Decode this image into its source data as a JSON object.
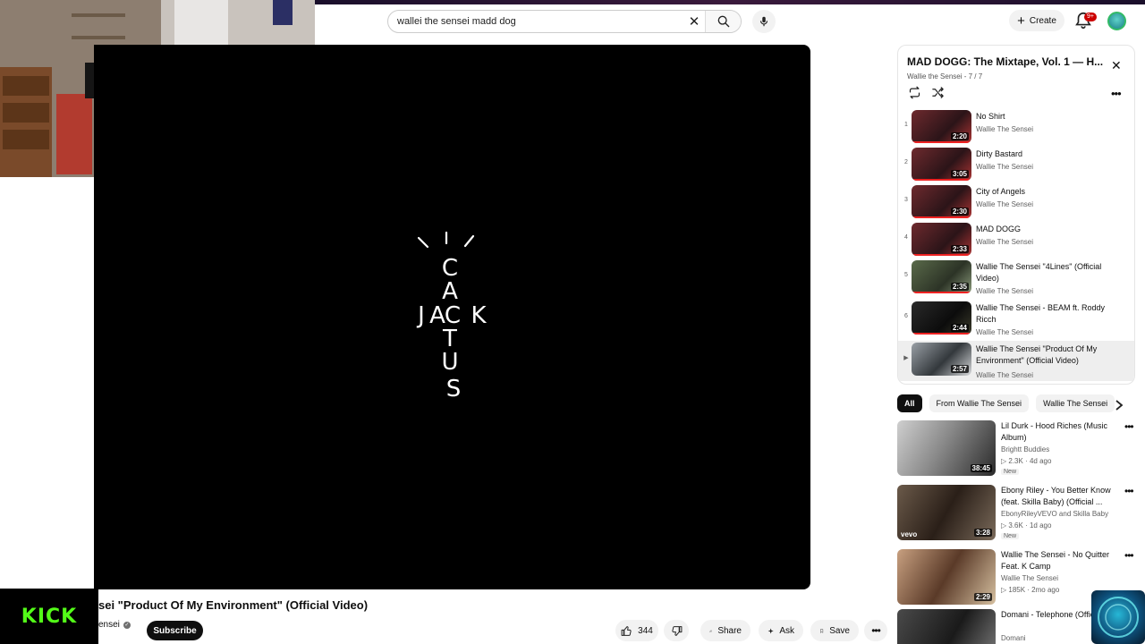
{
  "search": {
    "query": "wallei the sensei madd dog"
  },
  "header": {
    "create_label": "Create",
    "notification_count": "9+"
  },
  "overlay": {
    "kick_label": "KICK"
  },
  "video": {
    "logo_letters": [
      "C",
      "A",
      "J",
      "A",
      "C",
      "K",
      "T",
      "U",
      "S"
    ],
    "title": "sei \"Product Of My Environment\" (Official Video)",
    "channel": "ensei",
    "subscribe_label": "Subscribe",
    "likes": "344",
    "share_label": "Share",
    "ask_label": "Ask",
    "save_label": "Save"
  },
  "playlist": {
    "title": "MAD DOGG: The Mixtape, Vol. 1 — H...",
    "subtitle": "Wallie the Sensei - 7 / 7",
    "items": [
      {
        "num": "1",
        "title": "No Shirt",
        "channel": "Wallie The Sensei",
        "duration": "2:20"
      },
      {
        "num": "2",
        "title": "Dirty Bastard",
        "channel": "Wallie The Sensei",
        "duration": "3:05"
      },
      {
        "num": "3",
        "title": "City of Angels",
        "channel": "Wallie The Sensei",
        "duration": "2:30"
      },
      {
        "num": "4",
        "title": "MAD DOGG",
        "channel": "Wallie The Sensei",
        "duration": "2:33"
      },
      {
        "num": "5",
        "title": "Wallie The Sensei \"4Lines\" (Official Video)",
        "channel": "Wallie The Sensei",
        "duration": "2:35"
      },
      {
        "num": "6",
        "title": "Wallie The Sensei - BEAM ft. Roddy Ricch",
        "channel": "Wallie The Sensei",
        "duration": "2:44"
      },
      {
        "num": "▶",
        "title": "Wallie The Sensei \"Product Of My Environment\" (Official Video)",
        "channel": "Wallie The Sensei",
        "duration": "2:57"
      }
    ]
  },
  "chips": [
    "All",
    "From Wallie The Sensei",
    "Wallie The Sensei"
  ],
  "recommended": [
    {
      "title": "Lil Durk - Hood Riches (Music Album)",
      "channel": "Brightt Buddies",
      "views": "2.3K",
      "age": "4d ago",
      "badge": "New",
      "duration": "38:45"
    },
    {
      "title": "Ebony Riley - You Better Know (feat. Skilla Baby) (Official ...",
      "channel": "EbonyRileyVEVO and Skilla Baby",
      "views": "3.6K",
      "age": "1d ago",
      "badge": "New",
      "duration": "3:28",
      "logo": "vevo"
    },
    {
      "title": "Wallie The Sensei - No Quitter Feat. K Camp",
      "channel": "Wallie The Sensei",
      "views": "185K",
      "age": "2mo ago",
      "badge": "",
      "duration": "2:29"
    },
    {
      "title": "Domani - Telephone (Official Video)",
      "channel": "Domani",
      "views": "",
      "age": "",
      "badge": "",
      "duration": ""
    }
  ],
  "colors": {
    "kick_green": "#53fc18",
    "accent_red": "#cc0000"
  }
}
